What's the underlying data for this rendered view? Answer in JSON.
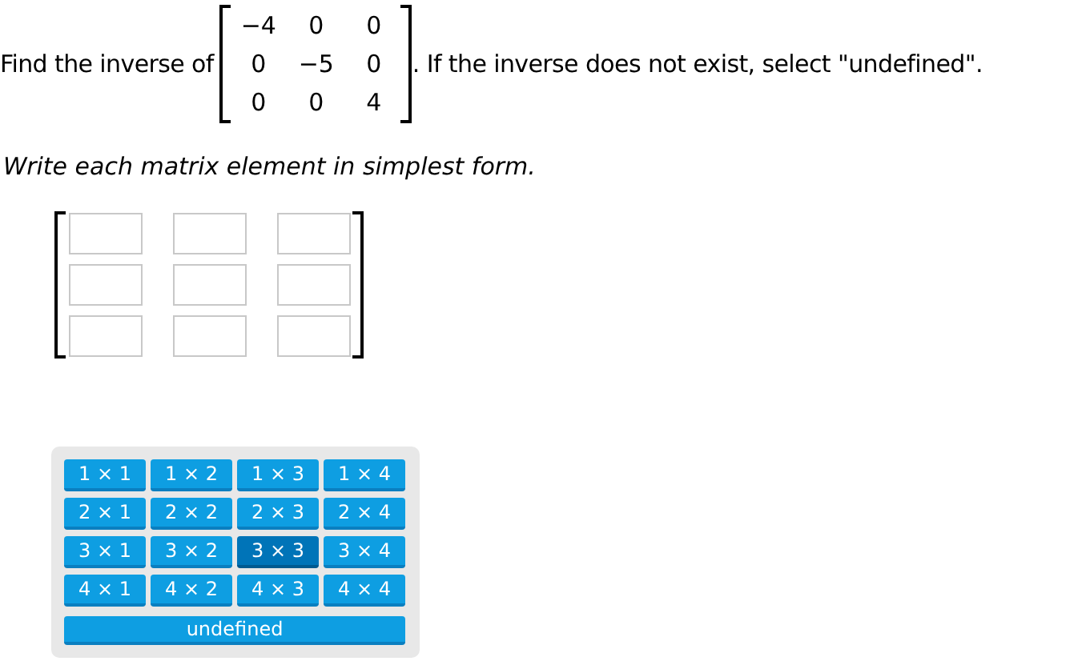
{
  "question": {
    "prefix": "Find the inverse of",
    "matrix": [
      [
        "−4",
        "0",
        "0"
      ],
      [
        "0",
        "−5",
        "0"
      ],
      [
        "0",
        "0",
        "4"
      ]
    ],
    "suffix": ". If the inverse does not exist, select \"undefined\"."
  },
  "instruction": "Write each matrix element in simplest form.",
  "answer_matrix": [
    [
      {
        "kind": "blank"
      },
      {
        "kind": "blank"
      },
      {
        "kind": "blank"
      }
    ],
    [
      {
        "kind": "blank"
      },
      {
        "kind": "blank"
      },
      {
        "kind": "blank"
      }
    ],
    [
      {
        "kind": "blank"
      },
      {
        "kind": "blank"
      },
      {
        "kind": "blank"
      }
    ]
  ],
  "size_picker": [
    [
      {
        "label": "1 × 1",
        "selected": false
      },
      {
        "label": "1 × 2",
        "selected": false
      },
      {
        "label": "1 × 3",
        "selected": false
      },
      {
        "label": "1 × 4",
        "selected": false
      }
    ],
    [
      {
        "label": "2 × 1",
        "selected": false
      },
      {
        "label": "2 × 2",
        "selected": false
      },
      {
        "label": "2 × 3",
        "selected": false
      },
      {
        "label": "2 × 4",
        "selected": false
      }
    ],
    [
      {
        "label": "3 × 1",
        "selected": false
      },
      {
        "label": "3 × 2",
        "selected": false
      },
      {
        "label": "3 × 3",
        "selected": true
      },
      {
        "label": "3 × 4",
        "selected": false
      }
    ],
    [
      {
        "label": "4 × 1",
        "selected": false
      },
      {
        "label": "4 × 2",
        "selected": false
      },
      {
        "label": "4 × 3",
        "selected": false
      },
      {
        "label": "4 × 4",
        "selected": false
      }
    ]
  ],
  "undefined_button": "undefined"
}
